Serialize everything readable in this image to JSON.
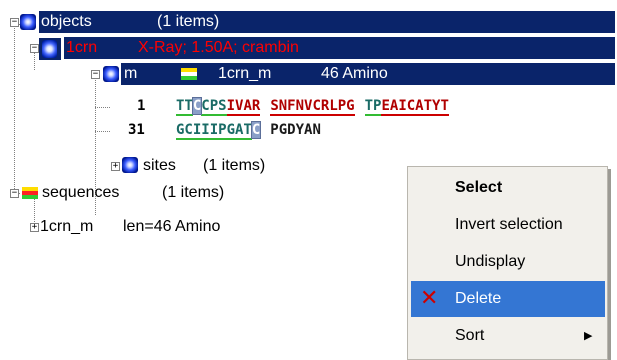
{
  "tree": {
    "objects": {
      "label": "objects",
      "count": "(1 items)"
    },
    "molecule": {
      "id": "1crn",
      "desc": "X-Ray; 1.50A; crambin"
    },
    "chain": {
      "id": "m",
      "name": "1crn_m",
      "info": "46 Amino"
    },
    "seq_line1": {
      "num": "1",
      "blocks": [
        [
          {
            "t": "TT"
          },
          {
            "t": "C",
            "box": true
          },
          {
            "t": "CPS"
          },
          {
            "t": "IVAR",
            "red": true
          }
        ],
        [
          {
            "t": "SNFNVCRLPG",
            "red": true
          }
        ],
        [
          {
            "t": "TP"
          },
          {
            "t": "EAICATYT",
            "red": true
          }
        ]
      ]
    },
    "seq_line2": {
      "num": "31",
      "blocks": [
        [
          {
            "t": "GCIIIPGAT"
          },
          {
            "t": "C",
            "box": true
          }
        ],
        [
          {
            "t": "PGDYAN"
          }
        ]
      ]
    },
    "sites": {
      "label": "sites",
      "count": "(1 items)"
    },
    "sequences": {
      "label": "sequences",
      "count": "(1 items)"
    },
    "seq_entry": {
      "name": "1crn_m",
      "info": "len=46 Amino"
    }
  },
  "context_menu": {
    "items": [
      {
        "label": "Select",
        "bold": true
      },
      {
        "label": "Invert selection"
      },
      {
        "label": "Undisplay"
      },
      {
        "label": "Delete",
        "icon": "delete-x-icon",
        "selected": true
      },
      {
        "label": "Sort",
        "submenu": true
      }
    ]
  },
  "colors": {
    "highlight": "#0a246a",
    "red_text": "#ff0000",
    "menu_select": "#3476d3",
    "seq_red": "#b00000",
    "underline_red": "#cc0000",
    "underline_green": "#33bb33"
  }
}
